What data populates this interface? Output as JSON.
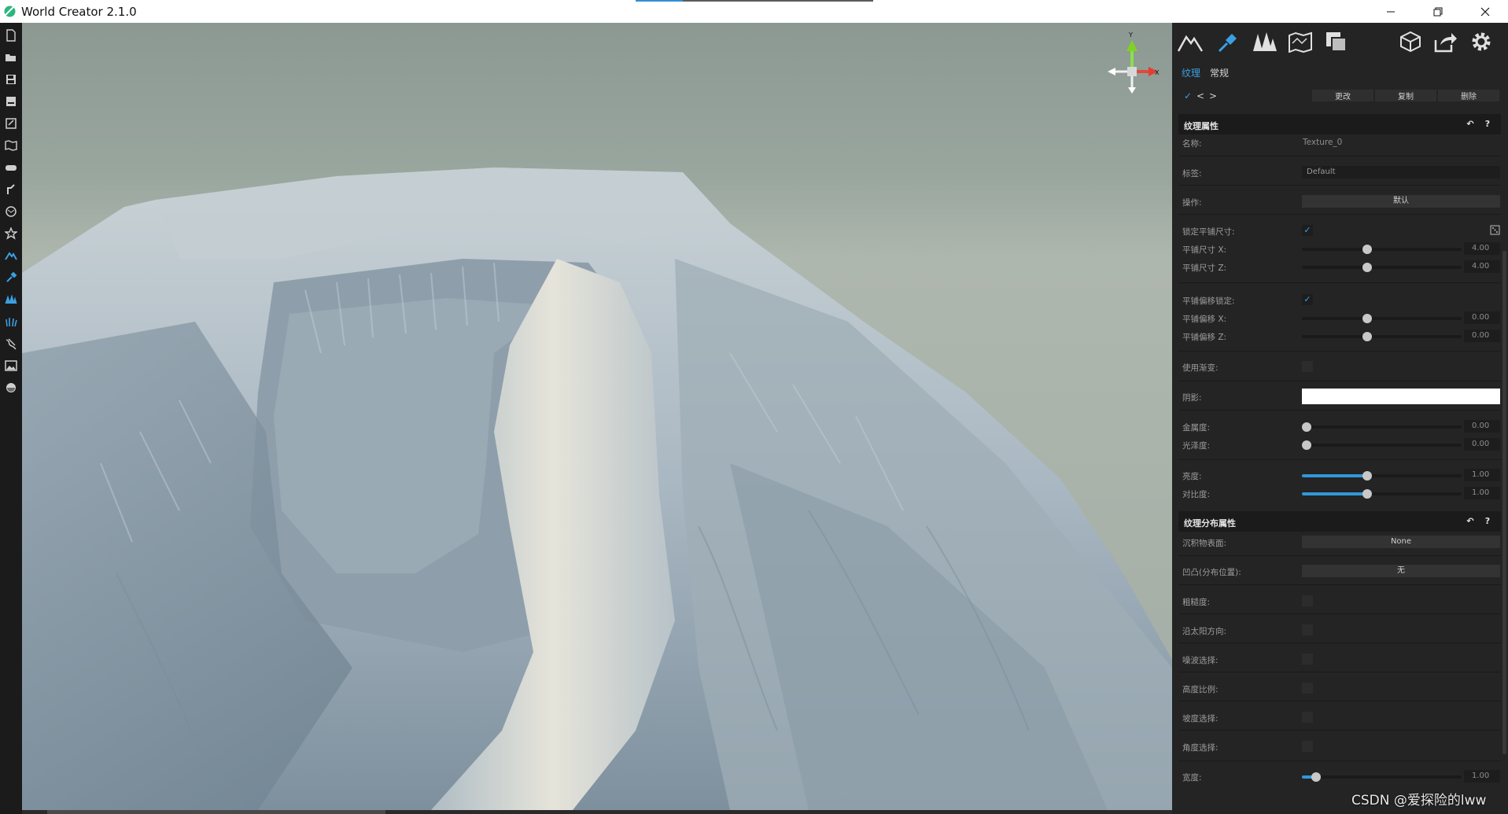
{
  "window": {
    "title": "World Creator 2.1.0",
    "loading_progress": 0.2,
    "controls": [
      "minimize-icon",
      "maximize-icon",
      "close-icon"
    ]
  },
  "left_toolbar": {
    "icons": [
      "new-file-icon",
      "open-folder-icon",
      "save-icon",
      "save-as-icon",
      "export-map-icon",
      "map-icon",
      "gamepad-icon",
      "brush-tool-icon",
      "globe-icon",
      "star-icon",
      "mountain-icon",
      "paint-brush-icon",
      "tree-icon",
      "grass-icon",
      "river-icon",
      "image-icon",
      "sphere-icon"
    ]
  },
  "viewport": {
    "gizmo": {
      "x_label": "X",
      "y_label": "Y"
    }
  },
  "panel": {
    "top_icons": [
      "terrain-icon",
      "texture-brush-icon",
      "trees-icon",
      "map-icon",
      "layers-icon",
      "cube-icon",
      "export-icon",
      "settings-icon"
    ],
    "tabs": [
      {
        "label": "纹理",
        "active": true
      },
      {
        "label": "常规",
        "active": false
      }
    ],
    "toolbar": {
      "check_label": "✓",
      "prev_label": "<",
      "next_label": ">",
      "change_label": "更改",
      "copy_label": "复制",
      "delete_label": "删除"
    },
    "texture_props": {
      "header": "纹理属性",
      "name_label": "名称:",
      "name_value": "Texture_0",
      "tag_label": "标签:",
      "tag_value": "Default",
      "op_label": "操作:",
      "op_value": "默认",
      "lock_tile_label": "锁定平铺尺寸:",
      "lock_tile_checked": "✓",
      "tile_x_label": "平铺尺寸 X:",
      "tile_x_value": "4.00",
      "tile_z_label": "平铺尺寸 Z:",
      "tile_z_value": "4.00",
      "lock_offset_label": "平铺偏移锁定:",
      "lock_offset_checked": "✓",
      "offset_x_label": "平铺偏移 X:",
      "offset_x_value": "0.00",
      "offset_z_label": "平铺偏移 Z:",
      "offset_z_value": "0.00",
      "gradient_label": "使用渐变:",
      "shadow_label": "阴影:",
      "shadow_color": "#ffffff",
      "metal_label": "金属度:",
      "metal_value": "0.00",
      "gloss_label": "光泽度:",
      "gloss_value": "0.00",
      "brightness_label": "亮度:",
      "brightness_value": "1.00",
      "contrast_label": "对比度:",
      "contrast_value": "1.00"
    },
    "distribution_props": {
      "header": "纹理分布属性",
      "sediment_label": "沉积物表面:",
      "sediment_value": "None",
      "bump_label": "凹凸(分布位置):",
      "bump_value": "无",
      "roughness_label": "粗糙度:",
      "sun_label": "沿太阳方向:",
      "noise_label": "噪波选择:",
      "height_label": "高度比例:",
      "slope_label": "坡度选择:",
      "angle_label": "角度选择:",
      "width_label": "宽度:",
      "width_value": "1.00"
    },
    "header_icons": {
      "back": "↶",
      "help": "?"
    }
  },
  "slider_levels": {
    "tile_x": 0.41,
    "tile_z": 0.41,
    "offset_x": 0.41,
    "offset_z": 0.41,
    "metal": 0.03,
    "gloss": 0.03,
    "brightness": 0.41,
    "contrast": 0.41,
    "width": 0.09
  },
  "colors": {
    "accent": "#3aa0e3",
    "panel_bg": "#242424",
    "toolbar_bg": "#1b1b1b"
  },
  "watermark": "CSDN @爱探险的lww"
}
